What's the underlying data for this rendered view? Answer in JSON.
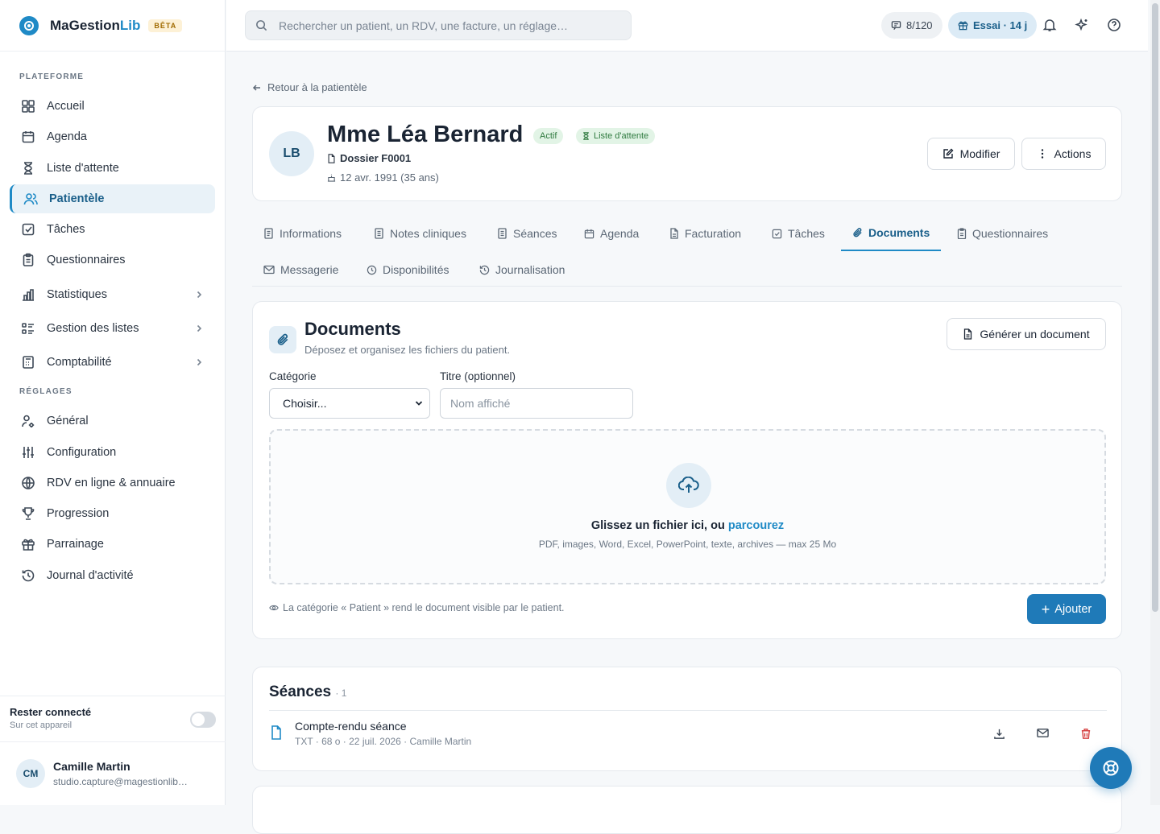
{
  "brand": {
    "name": "MaGestion",
    "name_accent": "Lib",
    "badge": "BÊTA"
  },
  "sidebar": {
    "section_platform": "PLATEFORME",
    "section_settings": "RÉGLAGES",
    "items": [
      {
        "label": "Accueil",
        "icon": "dashboard-icon"
      },
      {
        "label": "Agenda",
        "icon": "calendar-icon"
      },
      {
        "label": "Liste d'attente",
        "icon": "hourglass-icon"
      },
      {
        "label": "Patientèle",
        "icon": "users-icon",
        "active": true
      },
      {
        "label": "Tâches",
        "icon": "check-square-icon"
      },
      {
        "label": "Questionnaires",
        "icon": "clipboard-icon"
      },
      {
        "label": "Statistiques",
        "icon": "bar-chart-icon"
      },
      {
        "label": "Gestion des listes",
        "icon": "list-icon"
      },
      {
        "label": "Comptabilité",
        "icon": "calculator-icon"
      }
    ],
    "settings": [
      {
        "label": "Général",
        "icon": "user-gear-icon"
      },
      {
        "label": "Configuration",
        "icon": "sliders-icon"
      },
      {
        "label": "RDV en ligne & annuaire",
        "icon": "globe-icon"
      },
      {
        "label": "Progression",
        "icon": "trophy-icon"
      },
      {
        "label": "Parrainage",
        "icon": "gift-icon"
      },
      {
        "label": "Journal d'activité",
        "icon": "history-icon"
      }
    ],
    "stay_connected": {
      "title": "Rester connecté",
      "subtitle": "Sur cet appareil"
    },
    "user": {
      "initials": "CM",
      "name": "Camille Martin",
      "email": "studio.capture@magestionlib…"
    }
  },
  "topbar": {
    "search_placeholder": "Rechercher un patient, un RDV, une facture, un réglage…",
    "sms_count": "8/120",
    "trial": "Essai · 14 j"
  },
  "patient": {
    "back": "Retour à la patientèle",
    "initials": "LB",
    "name": "Mme Léa Bernard",
    "status": "Actif",
    "waitlist": "Liste d'attente",
    "file": "Dossier F0001",
    "birth": "12 avr. 1991 (35 ans)",
    "edit": "Modifier",
    "actions": "Actions"
  },
  "tabs": [
    {
      "label": "Informations",
      "icon": "file-icon"
    },
    {
      "label": "Notes cliniques",
      "icon": "notes-icon"
    },
    {
      "label": "Séances",
      "icon": "list-doc-icon"
    },
    {
      "label": "Agenda",
      "icon": "calendar-icon"
    },
    {
      "label": "Facturation",
      "icon": "invoice-icon"
    },
    {
      "label": "Tâches",
      "icon": "check-square-icon"
    },
    {
      "label": "Documents",
      "icon": "paperclip-icon",
      "active": true
    },
    {
      "label": "Questionnaires",
      "icon": "clipboard-icon"
    },
    {
      "label": "Messagerie",
      "icon": "mail-icon"
    },
    {
      "label": "Disponibilités",
      "icon": "clock-icon"
    },
    {
      "label": "Journalisation",
      "icon": "history-icon"
    }
  ],
  "documents": {
    "title": "Documents",
    "subtitle": "Déposez et organisez les fichiers du patient.",
    "generate": "Générer un document",
    "category_label": "Catégorie",
    "category_value": "Choisir...",
    "title_label": "Titre (optionnel)",
    "title_placeholder": "Nom affiché",
    "drop_text": "Glissez un fichier ici, ou",
    "drop_link": "parcourez",
    "drop_formats": "PDF, images, Word, Excel, PowerPoint, texte, archives — max 25 Mo",
    "hint": "La catégorie « Patient » rend le document visible par le patient.",
    "add": "Ajouter"
  },
  "sessions": {
    "title": "Séances",
    "count": "· 1",
    "files": [
      {
        "name": "Compte-rendu séance",
        "meta": "TXT · 68 o · 22 juil. 2026 · Camille Martin"
      }
    ]
  },
  "colors": {
    "accent": "#1f8ac6",
    "primary_button": "#1f7ab8",
    "success_badge": "#e2f4e6",
    "danger": "#d64545"
  }
}
